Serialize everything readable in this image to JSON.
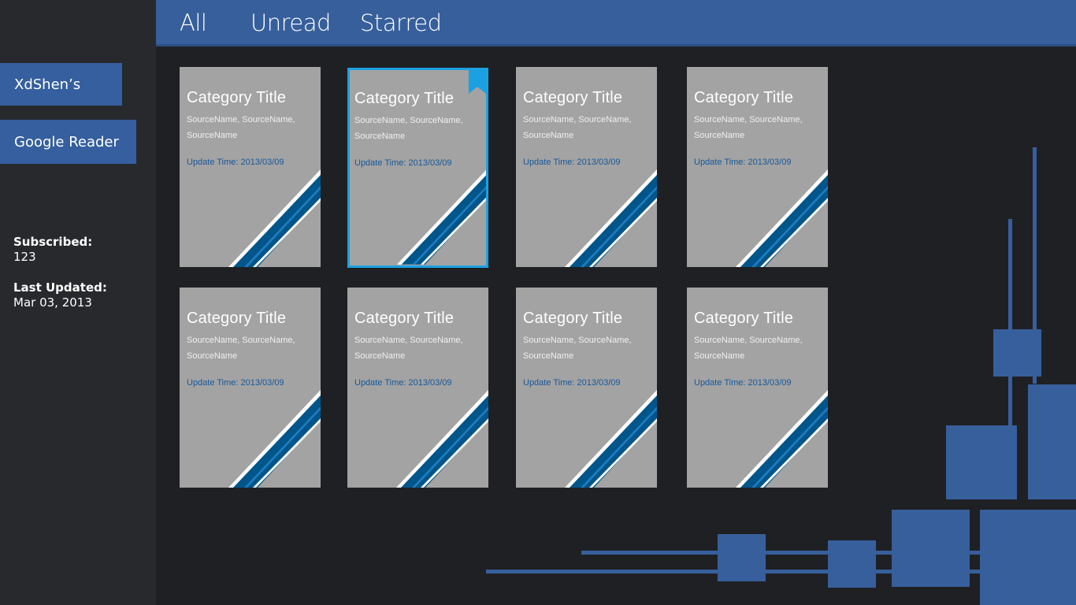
{
  "sidebar": {
    "buttons": [
      "XdShen’s",
      "Google Reader"
    ],
    "subscribed_label": "Subscribed:",
    "subscribed_value": "123",
    "last_updated_label": "Last Updated:",
    "last_updated_value": "Mar 03, 2013"
  },
  "tabs": [
    "All",
    "Unread",
    "Starred"
  ],
  "tiles": [
    {
      "title": "Category Title",
      "sources": "SourceName, SourceName, SourceName",
      "update": "Update Time: 2013/03/09",
      "selected": false
    },
    {
      "title": "Category Title",
      "sources": "SourceName, SourceName, SourceName",
      "update": "Update Time: 2013/03/09",
      "selected": true,
      "starred": true
    },
    {
      "title": "Category Title",
      "sources": "SourceName, SourceName, SourceName",
      "update": "Update Time: 2013/03/09",
      "selected": false
    },
    {
      "title": "Category Title",
      "sources": "SourceName, SourceName, SourceName",
      "update": "Update Time: 2013/03/09",
      "selected": false
    },
    {
      "title": "Category Title",
      "sources": "SourceName, SourceName, SourceName",
      "update": "Update Time: 2013/03/09",
      "selected": false
    },
    {
      "title": "Category Title",
      "sources": "SourceName, SourceName, SourceName",
      "update": "Update Time: 2013/03/09",
      "selected": false
    },
    {
      "title": "Category Title",
      "sources": "SourceName, SourceName, SourceName",
      "update": "Update Time: 2013/03/09",
      "selected": false
    },
    {
      "title": "Category Title",
      "sources": "SourceName, SourceName, SourceName",
      "update": "Update Time: 2013/03/09",
      "selected": false
    }
  ],
  "colors": {
    "accent": "#375f9c",
    "selection": "#1ba1e2",
    "tile": "#a3a3a3",
    "stripe": "#00558a"
  }
}
